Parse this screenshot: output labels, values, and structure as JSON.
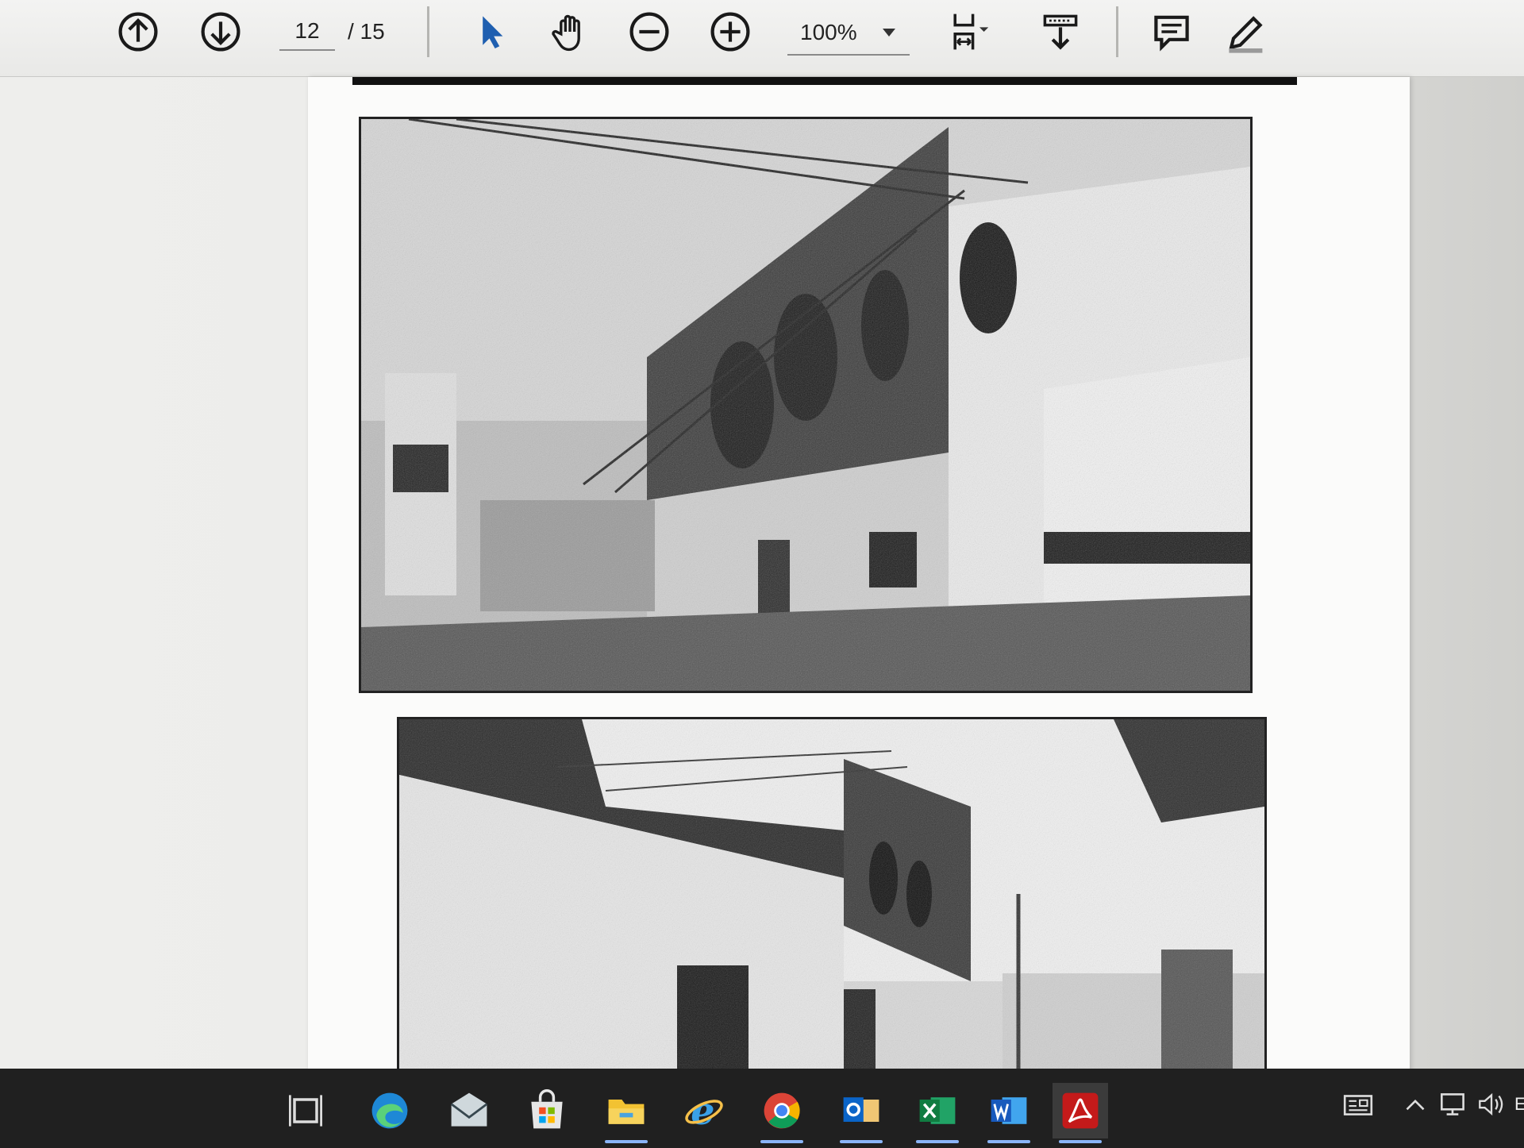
{
  "toolbar": {
    "page_current": "12",
    "page_total": "/ 15",
    "zoom": "100%",
    "icons": [
      "prev-page-icon",
      "next-page-icon",
      "select-cursor-icon",
      "hand-tool-icon",
      "zoom-out-icon",
      "zoom-in-icon",
      "fit-page-icon",
      "scroll-mode-icon",
      "comment-icon",
      "draw-icon"
    ]
  },
  "document": {
    "photos": [
      "street-house-photo-1",
      "street-house-photo-2"
    ]
  },
  "taskbar": {
    "apps": [
      "task-view",
      "edge",
      "mail",
      "store",
      "file-explorer",
      "internet-explorer",
      "chrome",
      "outlook",
      "excel",
      "word",
      "acrobat"
    ],
    "tray_lang": "E",
    "accent": "#8ab4f8"
  }
}
